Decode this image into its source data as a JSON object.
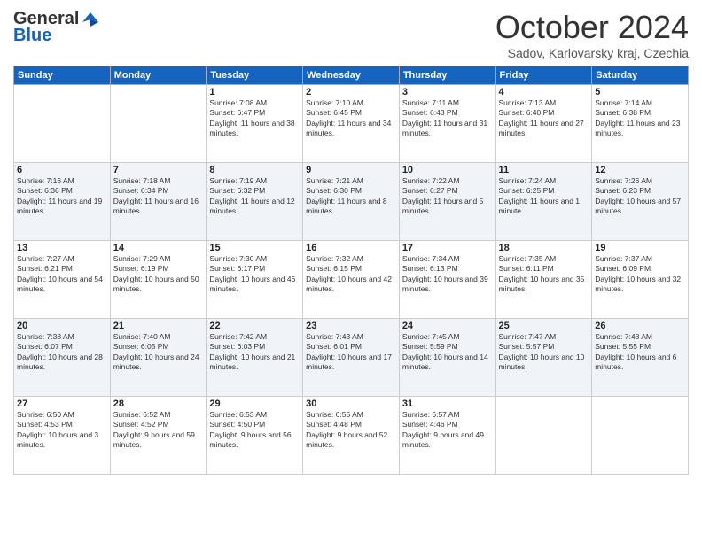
{
  "header": {
    "logo_general": "General",
    "logo_blue": "Blue",
    "month_title": "October 2024",
    "subtitle": "Sadov, Karlovarsky kraj, Czechia"
  },
  "days_of_week": [
    "Sunday",
    "Monday",
    "Tuesday",
    "Wednesday",
    "Thursday",
    "Friday",
    "Saturday"
  ],
  "weeks": [
    [
      {
        "day": "",
        "info": ""
      },
      {
        "day": "",
        "info": ""
      },
      {
        "day": "1",
        "info": "Sunrise: 7:08 AM\nSunset: 6:47 PM\nDaylight: 11 hours and 38 minutes."
      },
      {
        "day": "2",
        "info": "Sunrise: 7:10 AM\nSunset: 6:45 PM\nDaylight: 11 hours and 34 minutes."
      },
      {
        "day": "3",
        "info": "Sunrise: 7:11 AM\nSunset: 6:43 PM\nDaylight: 11 hours and 31 minutes."
      },
      {
        "day": "4",
        "info": "Sunrise: 7:13 AM\nSunset: 6:40 PM\nDaylight: 11 hours and 27 minutes."
      },
      {
        "day": "5",
        "info": "Sunrise: 7:14 AM\nSunset: 6:38 PM\nDaylight: 11 hours and 23 minutes."
      }
    ],
    [
      {
        "day": "6",
        "info": "Sunrise: 7:16 AM\nSunset: 6:36 PM\nDaylight: 11 hours and 19 minutes."
      },
      {
        "day": "7",
        "info": "Sunrise: 7:18 AM\nSunset: 6:34 PM\nDaylight: 11 hours and 16 minutes."
      },
      {
        "day": "8",
        "info": "Sunrise: 7:19 AM\nSunset: 6:32 PM\nDaylight: 11 hours and 12 minutes."
      },
      {
        "day": "9",
        "info": "Sunrise: 7:21 AM\nSunset: 6:30 PM\nDaylight: 11 hours and 8 minutes."
      },
      {
        "day": "10",
        "info": "Sunrise: 7:22 AM\nSunset: 6:27 PM\nDaylight: 11 hours and 5 minutes."
      },
      {
        "day": "11",
        "info": "Sunrise: 7:24 AM\nSunset: 6:25 PM\nDaylight: 11 hours and 1 minute."
      },
      {
        "day": "12",
        "info": "Sunrise: 7:26 AM\nSunset: 6:23 PM\nDaylight: 10 hours and 57 minutes."
      }
    ],
    [
      {
        "day": "13",
        "info": "Sunrise: 7:27 AM\nSunset: 6:21 PM\nDaylight: 10 hours and 54 minutes."
      },
      {
        "day": "14",
        "info": "Sunrise: 7:29 AM\nSunset: 6:19 PM\nDaylight: 10 hours and 50 minutes."
      },
      {
        "day": "15",
        "info": "Sunrise: 7:30 AM\nSunset: 6:17 PM\nDaylight: 10 hours and 46 minutes."
      },
      {
        "day": "16",
        "info": "Sunrise: 7:32 AM\nSunset: 6:15 PM\nDaylight: 10 hours and 42 minutes."
      },
      {
        "day": "17",
        "info": "Sunrise: 7:34 AM\nSunset: 6:13 PM\nDaylight: 10 hours and 39 minutes."
      },
      {
        "day": "18",
        "info": "Sunrise: 7:35 AM\nSunset: 6:11 PM\nDaylight: 10 hours and 35 minutes."
      },
      {
        "day": "19",
        "info": "Sunrise: 7:37 AM\nSunset: 6:09 PM\nDaylight: 10 hours and 32 minutes."
      }
    ],
    [
      {
        "day": "20",
        "info": "Sunrise: 7:38 AM\nSunset: 6:07 PM\nDaylight: 10 hours and 28 minutes."
      },
      {
        "day": "21",
        "info": "Sunrise: 7:40 AM\nSunset: 6:05 PM\nDaylight: 10 hours and 24 minutes."
      },
      {
        "day": "22",
        "info": "Sunrise: 7:42 AM\nSunset: 6:03 PM\nDaylight: 10 hours and 21 minutes."
      },
      {
        "day": "23",
        "info": "Sunrise: 7:43 AM\nSunset: 6:01 PM\nDaylight: 10 hours and 17 minutes."
      },
      {
        "day": "24",
        "info": "Sunrise: 7:45 AM\nSunset: 5:59 PM\nDaylight: 10 hours and 14 minutes."
      },
      {
        "day": "25",
        "info": "Sunrise: 7:47 AM\nSunset: 5:57 PM\nDaylight: 10 hours and 10 minutes."
      },
      {
        "day": "26",
        "info": "Sunrise: 7:48 AM\nSunset: 5:55 PM\nDaylight: 10 hours and 6 minutes."
      }
    ],
    [
      {
        "day": "27",
        "info": "Sunrise: 6:50 AM\nSunset: 4:53 PM\nDaylight: 10 hours and 3 minutes."
      },
      {
        "day": "28",
        "info": "Sunrise: 6:52 AM\nSunset: 4:52 PM\nDaylight: 9 hours and 59 minutes."
      },
      {
        "day": "29",
        "info": "Sunrise: 6:53 AM\nSunset: 4:50 PM\nDaylight: 9 hours and 56 minutes."
      },
      {
        "day": "30",
        "info": "Sunrise: 6:55 AM\nSunset: 4:48 PM\nDaylight: 9 hours and 52 minutes."
      },
      {
        "day": "31",
        "info": "Sunrise: 6:57 AM\nSunset: 4:46 PM\nDaylight: 9 hours and 49 minutes."
      },
      {
        "day": "",
        "info": ""
      },
      {
        "day": "",
        "info": ""
      }
    ]
  ]
}
